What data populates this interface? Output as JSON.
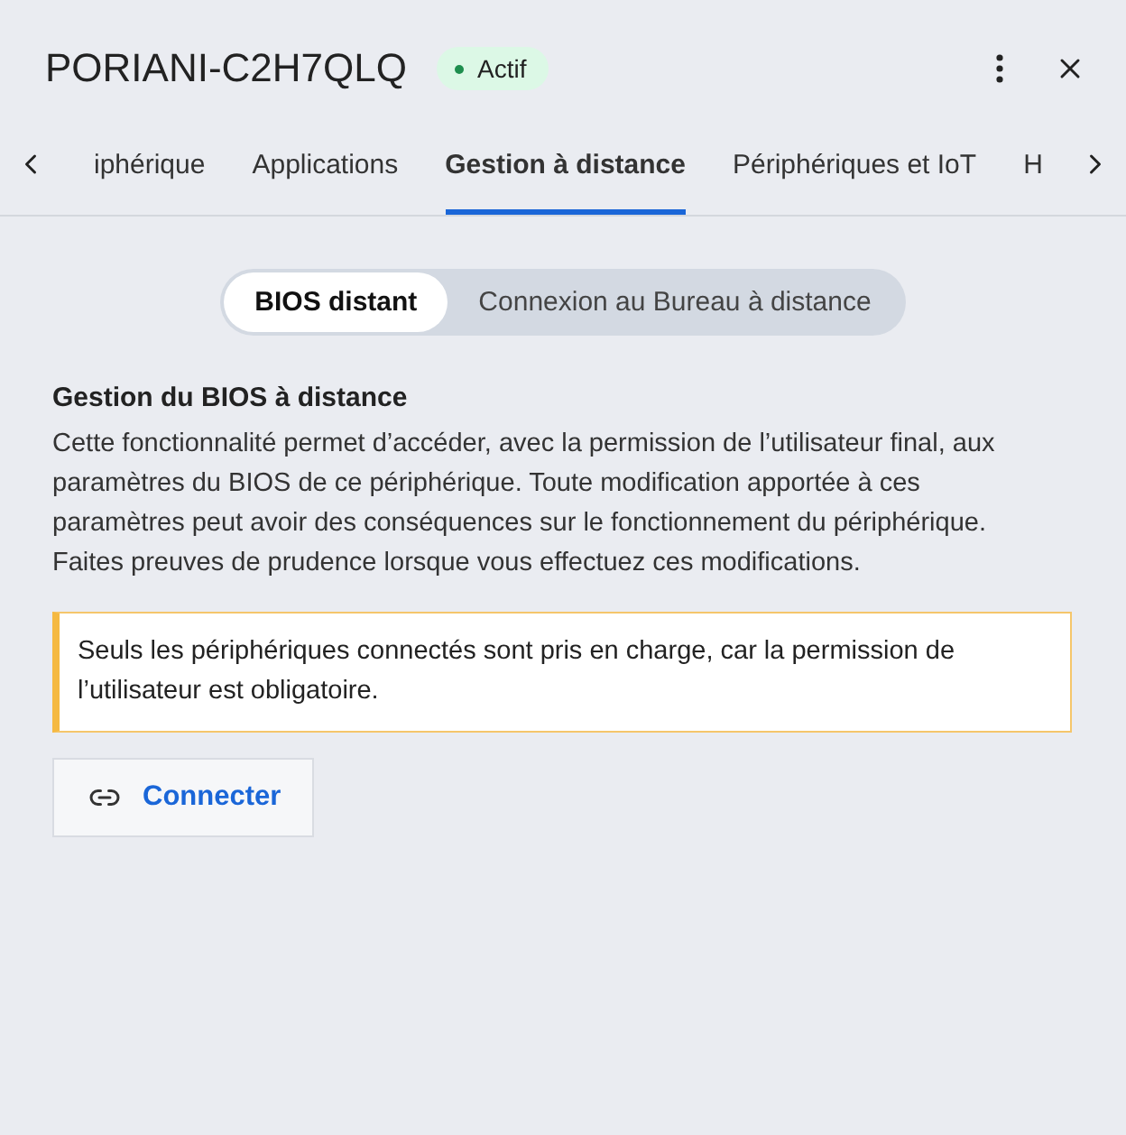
{
  "header": {
    "title": "PORIANI-C2H7QLQ",
    "status": {
      "label": "Actif",
      "color": "#1e8e4e"
    }
  },
  "tabs": [
    {
      "label": "iphérique",
      "selected": false
    },
    {
      "label": "Applications",
      "selected": false
    },
    {
      "label": "Gestion à distance",
      "selected": true
    },
    {
      "label": "Périphériques et IoT",
      "selected": false
    },
    {
      "label": "H",
      "selected": false
    }
  ],
  "segments": [
    {
      "label": "BIOS distant",
      "selected": true
    },
    {
      "label": "Connexion au Bureau à distance",
      "selected": false
    }
  ],
  "section": {
    "title": "Gestion du BIOS à distance",
    "description": "Cette fonctionnalité permet d’accéder, avec la permission de l’utilisateur final, aux paramètres du BIOS de ce périphérique. Toute modification apportée à ces paramètres peut avoir des conséquences sur le fonctionnement du périphérique. Faites preuves de prudence lorsque vous effectuez ces modifications.",
    "notice": "Seuls les périphériques connectés sont pris en charge, car la permission de l’utilisateur est obligatoire.",
    "button": "Connecter"
  }
}
